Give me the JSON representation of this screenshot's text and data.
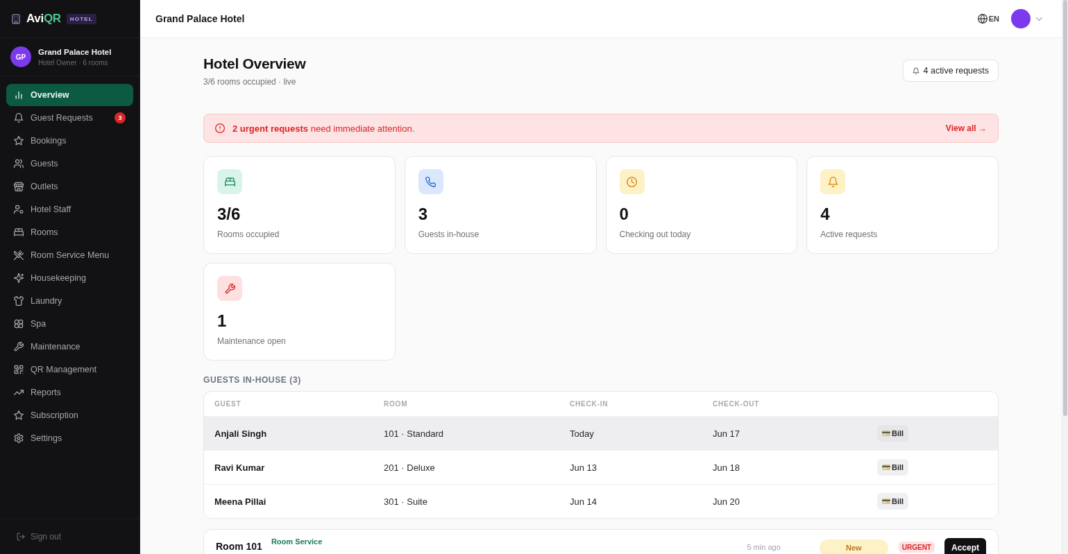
{
  "sidebar": {
    "logo": {
      "text": "Avi",
      "accent": "QR",
      "badge": "HOTEL"
    },
    "profile": {
      "initials": "GP",
      "name": "Grand Palace Hotel",
      "subtitle": "Hotel Owner · 6 rooms"
    },
    "items": [
      {
        "label": "Overview",
        "selected": true
      },
      {
        "label": "Guest Requests",
        "selected": false,
        "badge": "3"
      },
      {
        "label": "Bookings",
        "selected": false
      },
      {
        "label": "Guests",
        "selected": false
      },
      {
        "label": "Outlets",
        "selected": false
      },
      {
        "label": "Hotel Staff",
        "selected": false
      },
      {
        "label": "Rooms",
        "selected": false
      },
      {
        "label": "Room Service Menu",
        "selected": false
      },
      {
        "label": "Housekeeping",
        "selected": false
      },
      {
        "label": "Laundry",
        "selected": false
      },
      {
        "label": "Spa",
        "selected": false
      },
      {
        "label": "Maintenance",
        "selected": false
      },
      {
        "label": "QR Management",
        "selected": false
      },
      {
        "label": "Reports",
        "selected": false
      },
      {
        "label": "Subscription",
        "selected": false
      },
      {
        "label": "Settings",
        "selected": false
      }
    ],
    "sign_out": "Sign out"
  },
  "header": {
    "title": "Grand Palace Hotel",
    "language": "EN"
  },
  "page": {
    "title": "Hotel Overview",
    "subtitle": "3/6 rooms occupied · live",
    "requests_button": "4 active requests"
  },
  "alert": {
    "message": "**2 urgent requests** need immediate attention.",
    "link": "View all →"
  },
  "stats": [
    {
      "value": "3/6",
      "label": "Rooms occupied"
    },
    {
      "value": "3",
      "label": "Guests in-house"
    },
    {
      "value": "0",
      "label": "Checking out today"
    },
    {
      "value": "4",
      "label": "Active requests"
    },
    {
      "value": "1",
      "label": "Maintenance open"
    }
  ],
  "guests": {
    "heading": "GUESTS IN-HOUSE (3)",
    "columns": [
      "GUEST",
      "ROOM",
      "CHECK-IN",
      "CHECK-OUT"
    ],
    "rows": [
      {
        "guest": "Anjali Singh",
        "room": "101 · Standard",
        "check_in": "Today",
        "check_out": "Jun 17",
        "action": "Bill",
        "highlighted": true
      },
      {
        "guest": "Ravi Kumar",
        "room": "201 · Deluxe",
        "check_in": "Jun 13",
        "check_out": "Jun 18",
        "action": "Bill",
        "highlighted": false
      },
      {
        "guest": "Meena Pillai",
        "room": "301 · Suite",
        "check_in": "Jun 14",
        "check_out": "Jun 20",
        "action": "Bill",
        "highlighted": false
      }
    ]
  },
  "requests": [
    {
      "room": "Room 101",
      "type": "Room Service",
      "time": "5 min ago",
      "status": "New",
      "priority": "URGENT",
      "action": "Accept"
    }
  ]
}
